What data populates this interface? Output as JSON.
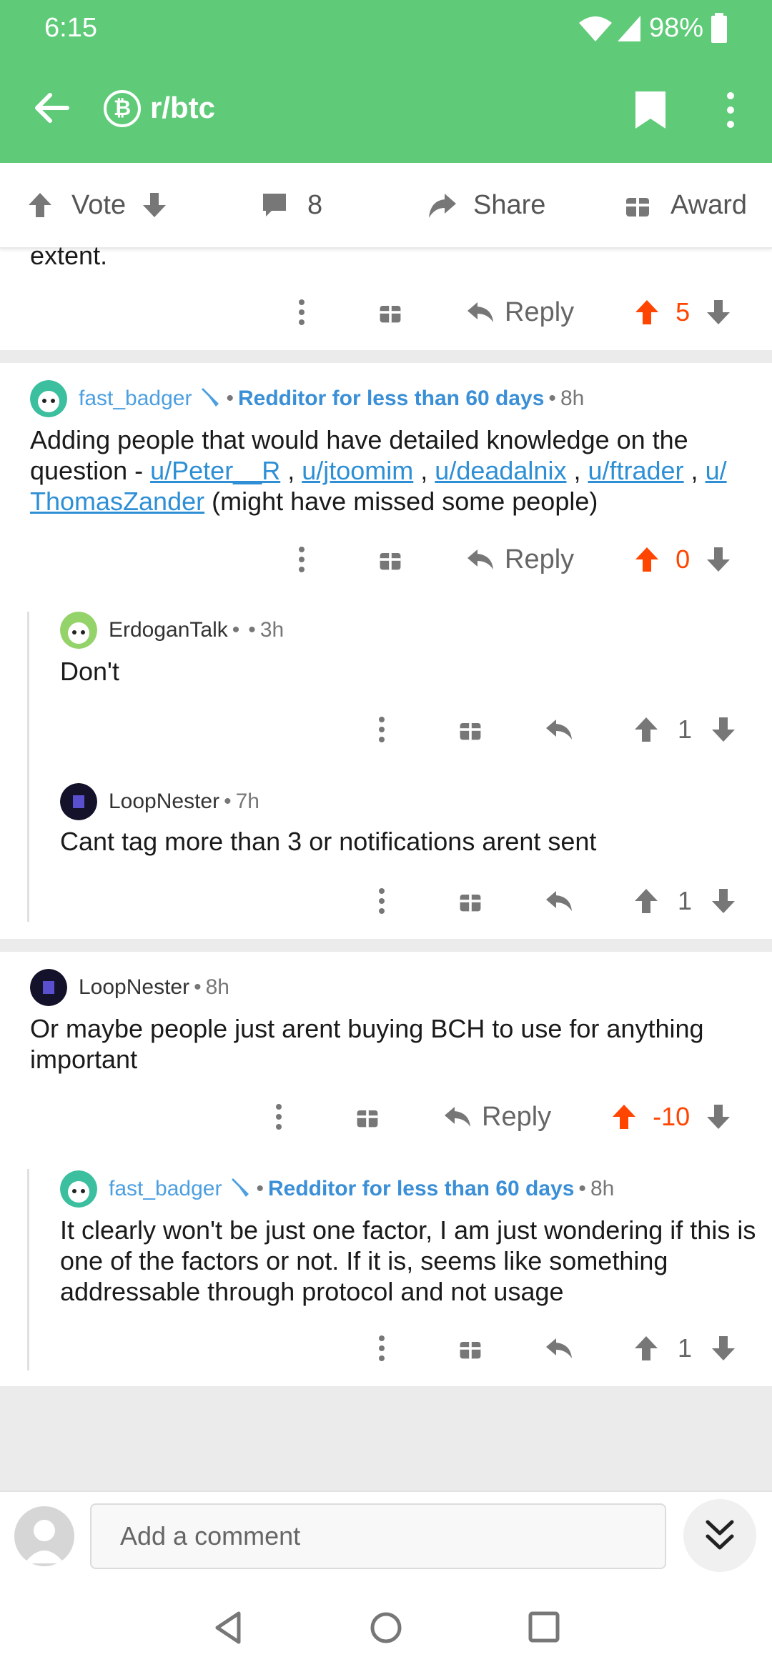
{
  "status": {
    "time": "6:15",
    "battery": "98%"
  },
  "header": {
    "subreddit": "r/btc"
  },
  "action_bar": {
    "vote_label": "Vote",
    "comment_count": "8",
    "share_label": "Share",
    "award_label": "Award"
  },
  "top_snippet": {
    "text": "extent.",
    "reply_label": "Reply",
    "score": "5"
  },
  "comments": [
    {
      "user": "fast_badger",
      "flair": "Redditor for less than 60 days",
      "age": "8h",
      "body_prefix": "Adding people that would have detailed knowledge on the question - ",
      "mentions": [
        "u/Peter__R",
        "u/jtoomim",
        "u/deadalnix",
        "u/ftrader",
        "u/",
        "ThomasZander"
      ],
      "body_suffix": " (might have missed some people)",
      "reply_label": "Reply",
      "score": "0"
    },
    {
      "user": "ErdoganTalk",
      "age": "3h",
      "body": "Don't",
      "score": "1"
    },
    {
      "user": "LoopNester",
      "age": "7h",
      "body": "Cant tag more than 3 or notifications arent sent",
      "score": "1"
    },
    {
      "user": "LoopNester",
      "age": "8h",
      "body": "Or maybe people just arent buying BCH to use for anything important",
      "reply_label": "Reply",
      "score": "-10"
    },
    {
      "user": "fast_badger",
      "flair": "Redditor for less than 60 days",
      "age": "8h",
      "body": "It clearly won't be just one factor, I am just wondering if this is one of the factors or not. If it is, seems like something addressable through protocol and not usage",
      "score": "1"
    }
  ],
  "composer": {
    "placeholder": "Add a comment"
  },
  "sep": {
    "dot": "•",
    "comma": " , "
  },
  "colors": {
    "header": "#5fcb78",
    "upvote": "#ff4500",
    "link": "#2e8fd5",
    "flair": "#3a8fd6"
  }
}
